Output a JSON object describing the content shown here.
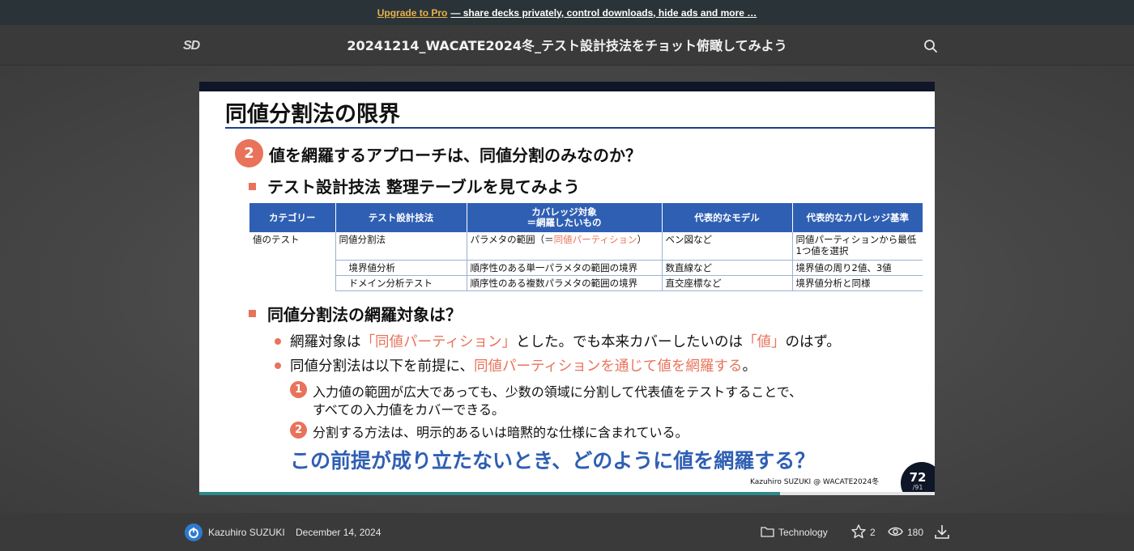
{
  "promo": {
    "link": "Upgrade to Pro",
    "rest": "— share decks privately, control downloads, hide ads and more …"
  },
  "header": {
    "logo": "SD",
    "title": "20241214_WACATE2024冬_テスト設計技法をチョット俯瞰してみよう"
  },
  "slide": {
    "title": "同値分割法の限界",
    "q_num": "2",
    "question": "値を網羅するアプローチは、同値分割のみなのか？",
    "h_table": "テスト設計技法 整理テーブルを見てみよう",
    "table": {
      "headers": [
        "カテゴリー",
        "テスト設計技法",
        "カバレッジ対象\n＝網羅したいもの",
        "代表的なモデル",
        "代表的なカバレッジ基準"
      ],
      "rows": [
        [
          "値のテスト",
          "同値分割法",
          "パラメタの範囲（＝同値パーティション）",
          "ベン図など",
          "同値パーティションから最低1つ値を選択"
        ],
        [
          "",
          "境界値分析",
          "順序性のある単一パラメタの範囲の境界",
          "数直線など",
          "境界値の周り2値、3値"
        ],
        [
          "",
          "ドメイン分析テスト",
          "順序性のある複数パラメタの範囲の境界",
          "直交座標など",
          "境界値分析と同様"
        ]
      ],
      "row1_c3_pre": "パラメタの範囲（＝",
      "row1_c3_hl": "同値パーティション",
      "row1_c3_post": "）"
    },
    "h_target": "同値分割法の網羅対象は？",
    "b1": {
      "pre": "網羅対象は",
      "hl1": "「同値パーティション」",
      "mid": "とした。でも本来カバーしたいのは",
      "hl2": "「値」",
      "post": "のはず。"
    },
    "b2": {
      "pre": "同値分割法は以下を前提に、",
      "hl": "同値パーティションを通じて値を網羅する",
      "post": "。"
    },
    "s1_num": "1",
    "s1_line1": "入力値の範囲が広大であっても、少数の領域に分割して代表値をテストすることで、",
    "s1_line2": "すべての入力値をカバーできる。",
    "s2_num": "2",
    "s2_text": "分割する方法は、明示的あるいは暗黙的な仕様に含まれている。",
    "conclusion": "この前提が成り立たないとき、どのように値を網羅する？",
    "credit": "Kazuhiro SUZUKI @ WACATE2024冬",
    "page": "72",
    "total": "/91",
    "progress": 0.79
  },
  "footer": {
    "author": "Kazuhiro SUZUKI",
    "date": "December 14, 2024",
    "category": "Technology",
    "stars": "2",
    "views": "180"
  },
  "colors": {
    "accent": "#e8735a",
    "blue": "#2f5fb3",
    "promo": "#e8b24a"
  }
}
